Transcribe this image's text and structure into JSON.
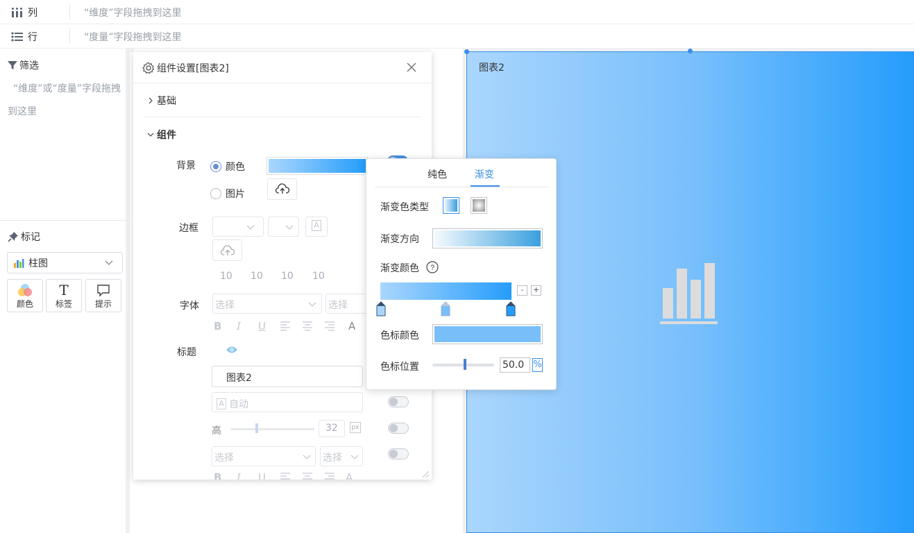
{
  "shelves": {
    "columns": {
      "label": "列",
      "hint": "“维度”字段拖拽到这里"
    },
    "rows": {
      "label": "行",
      "hint": "“度量”字段拖拽到这里"
    }
  },
  "left": {
    "filter_title": "筛选",
    "filter_hint": "“维度”或“度量”字段拖拽到这里",
    "mark_title": "标记",
    "chart_type": "柱图",
    "mark_buttons": [
      "颜色",
      "标签",
      "提示"
    ]
  },
  "chart": {
    "title": "图表2",
    "accent": "#259dfc"
  },
  "dialog": {
    "title": "组件设置[图表2]",
    "section_basic": "基础",
    "section_component": "组件",
    "background_label": "背景",
    "bg_color_option": "颜色",
    "bg_image_option": "图片",
    "border_label": "边框",
    "padding_values": [
      "10",
      "10",
      "10",
      "10"
    ],
    "font_label": "字体",
    "font_select_placeholder": "选择",
    "font_size_placeholder": "选择",
    "title_label": "标题",
    "title_input_value": "图表2",
    "auto_label": "自动",
    "height_label": "高",
    "height_value": "32",
    "unit_px": "px",
    "select_placeholder": "选择",
    "select2_placeholder": "选择"
  },
  "popover": {
    "tab_solid": "纯色",
    "tab_gradient": "渐变",
    "gradient_type_label": "渐变色类型",
    "gradient_direction_label": "渐变方向",
    "gradient_colors_label": "渐变颜色",
    "minus": "-",
    "plus": "+",
    "stop_color_label": "色标颜色",
    "stop_position_label": "色标位置",
    "stop_position_value": "50.0",
    "percent": "%",
    "gradient_start_color": "#aad6fd",
    "gradient_end_color": "#259dfc",
    "stop_color": "#78bffa"
  }
}
